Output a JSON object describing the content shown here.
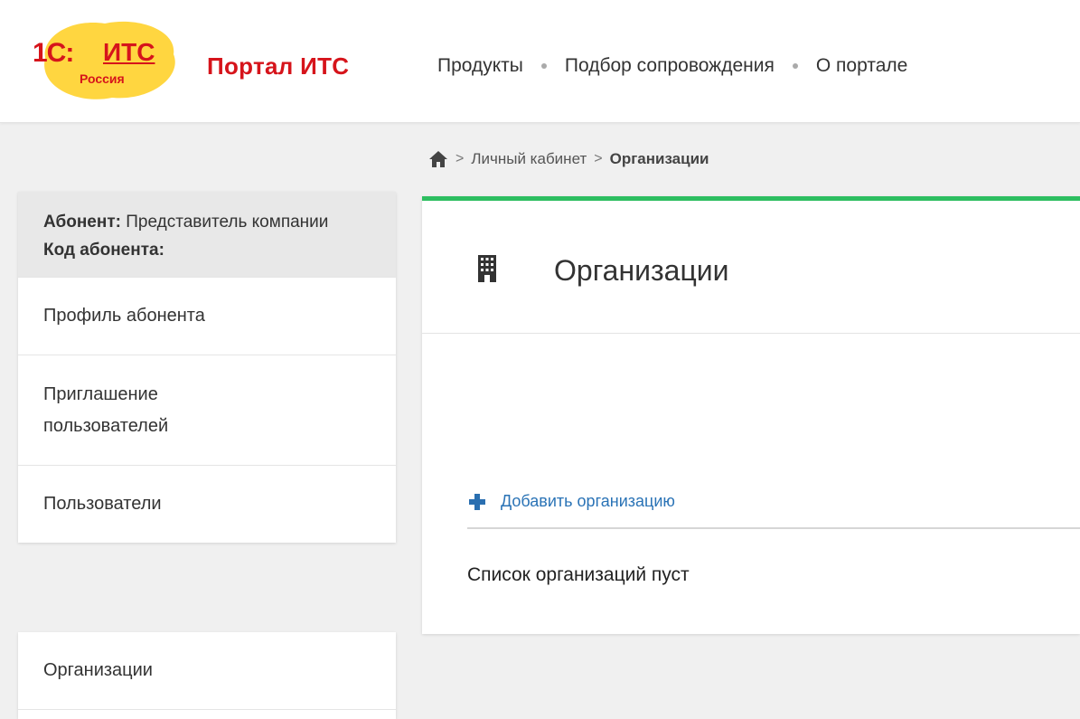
{
  "header": {
    "logo": {
      "brand": "1С:ИТС",
      "region": "Россия"
    },
    "portal_title": "Портал ИТС",
    "nav": [
      "Продукты",
      "Подбор сопровождения",
      "О портале"
    ]
  },
  "breadcrumb": {
    "home_icon": "home-icon",
    "items": [
      "Личный кабинет",
      "Организации"
    ]
  },
  "sidebar": {
    "subscriber_label": "Абонент:",
    "subscriber_value": " Представитель компании",
    "code_label": "Код абонента:",
    "items": [
      "Профиль абонента",
      "Приглашение пользователей",
      "Пользователи"
    ],
    "items2": [
      "Организации"
    ]
  },
  "main": {
    "icon": "building-icon",
    "title": "Организации",
    "add_label": "Добавить организацию",
    "empty_text": "Список организаций пуст"
  },
  "colors": {
    "brand_red": "#d6141b",
    "accent_green": "#2dbe60",
    "link_blue": "#2a73b6"
  }
}
